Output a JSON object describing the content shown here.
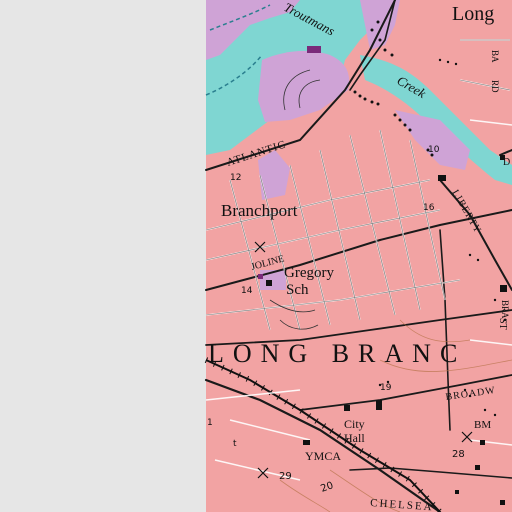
{
  "colors": {
    "blank": "#e6e6e6",
    "urban": "#f2a3a3",
    "water": "#7fd6d2",
    "marsh": "#cfa3d6",
    "road": "#1a1a1a",
    "building": "#111111",
    "school": "#7a2a7a"
  },
  "labels": {
    "long_top": "Long",
    "troutmans": "Troutmans",
    "creek": "Creek",
    "atlantic": "ATLANTIC",
    "branchport": "Branchport",
    "joline": "JOLINE",
    "gregory": "Gregory",
    "sch": "Sch",
    "long_branch": "LONG BRANC",
    "broadway": "BROADW",
    "city": "City",
    "hall": "Hall",
    "ymca": "YMCA",
    "bm": "BM",
    "chelsea": "CHELSEA",
    "liberty": "LIBERTY",
    "st": "ST",
    "d_label": "D",
    "ba": "BA",
    "rd": "RD",
    "bra": "BRA"
  },
  "elevations": {
    "e12": "12",
    "e16": "16",
    "e14": "14",
    "e19": "19",
    "e10": "10",
    "e28": "28",
    "e29": "29",
    "e20": "20",
    "e1": "1",
    "t": "t"
  }
}
